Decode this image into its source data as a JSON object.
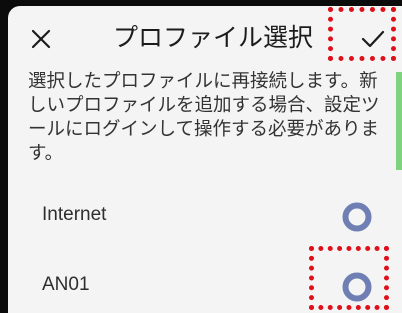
{
  "header": {
    "title": "プロファイル選択",
    "close_icon": "close-icon",
    "confirm_icon": "checkmark-icon"
  },
  "description": "選択したプロファイルに再接続します。新しいプロファイルを追加する場合、設定ツールにログインして操作する必要があります。",
  "profiles": [
    {
      "label": "Internet",
      "selected": false
    },
    {
      "label": "AN01",
      "selected": false
    }
  ],
  "colors": {
    "background": "#f3f4f3",
    "radio_ring": "#6f7fb4",
    "highlight": "#e0101b",
    "edge_bar": "#7fd37f"
  }
}
